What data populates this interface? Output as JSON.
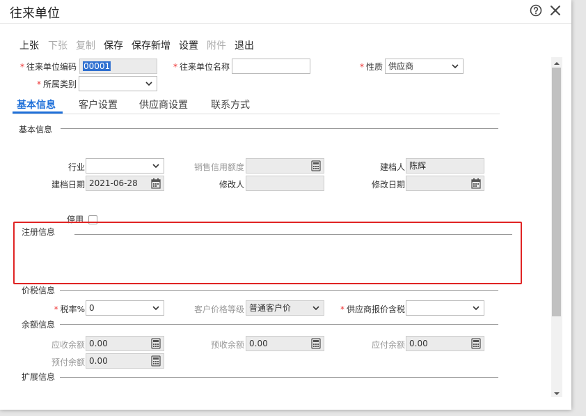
{
  "window": {
    "title": "往来单位"
  },
  "toolbar": {
    "prev": "上张",
    "next": "下张",
    "copy": "复制",
    "save": "保存",
    "save_new": "保存新增",
    "settings": "设置",
    "attach": "附件",
    "exit": "退出"
  },
  "form": {
    "code_label": "往来单位编码",
    "code_value": "00001",
    "name_label": "往来单位名称",
    "name_value": "",
    "nature_label": "性质",
    "nature_value": "供应商",
    "category_label": "所属类别",
    "category_value": ""
  },
  "tabs": {
    "basic": "基本信息",
    "customer": "客户设置",
    "supplier": "供应商设置",
    "contact": "联系方式"
  },
  "basic": {
    "section": "基本信息",
    "industry_label": "行业",
    "industry_value": "",
    "credit_label": "销售信用额度",
    "credit_value": "",
    "creator_label": "建档人",
    "creator_value": "陈辉",
    "created_label": "建档日期",
    "created_value": "2021-06-28",
    "modifier_label": "修改人",
    "modifier_value": "",
    "modified_label": "修改日期",
    "modified_value": "",
    "disabled_label": "停用"
  },
  "register": {
    "section": "注册信息"
  },
  "price_tax": {
    "section": "价税信息",
    "tax_label": "税率%",
    "tax_value": "0",
    "level_label": "客户价格等级",
    "level_value": "普通客户价",
    "supplier_tax_label": "供应商报价含税",
    "supplier_tax_value": ""
  },
  "balance": {
    "section": "余额信息",
    "receivable_label": "应收余额",
    "receivable_value": "0.00",
    "prereceive_label": "预收余额",
    "prereceive_value": "0.00",
    "payable_label": "应付余额",
    "payable_value": "0.00",
    "prepay_label": "预付余额",
    "prepay_value": "0.00"
  },
  "extend": {
    "section": "扩展信息"
  }
}
